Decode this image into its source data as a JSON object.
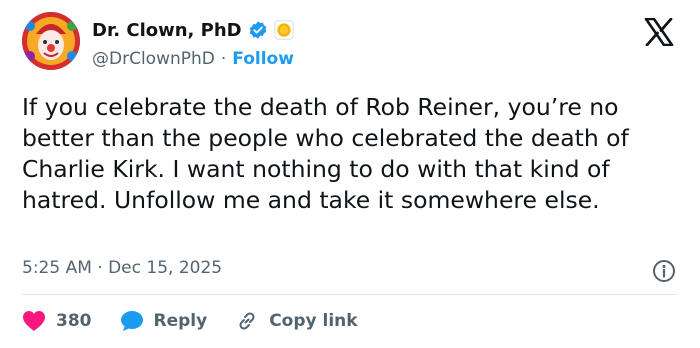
{
  "author": {
    "display_name": "Dr. Clown, PhD",
    "handle": "@DrClownPhD",
    "follow_label": "Follow",
    "separator": "·"
  },
  "tweet": {
    "text": "If you celebrate the death of Rob Reiner, you’re no better than the people who celebrated the death of Charlie Kirk. I want nothing to do with that kind of hatred. Unfollow me and take it somewhere else.",
    "timestamp": "5:25 AM · Dec 15, 2025"
  },
  "actions": {
    "like_count": "380",
    "reply_label": "Reply",
    "copy_link_label": "Copy link"
  },
  "colors": {
    "accent": "#1d9bf0",
    "like": "#f91880",
    "secondary_text": "#536471"
  },
  "icons": [
    "verified-badge-icon",
    "emoji-badge-icon",
    "x-logo-icon",
    "info-icon",
    "heart-icon",
    "reply-bubble-icon",
    "link-icon"
  ]
}
